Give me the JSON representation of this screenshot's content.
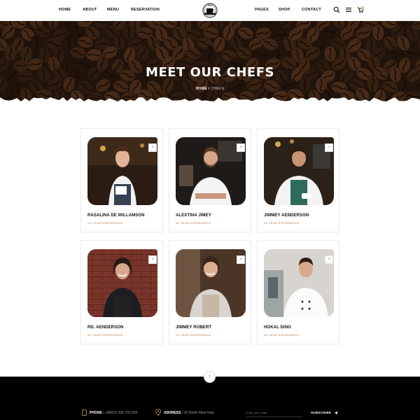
{
  "nav": {
    "left": [
      "HOME",
      "ABOUT",
      "MENU",
      "RESERVATION"
    ],
    "right": [
      "PAGES",
      "SHOP",
      "CONTACT"
    ],
    "cart_count": "0"
  },
  "hero": {
    "title": "MEET OUR CHEFS",
    "breadcrumb_home": "HOME",
    "breadcrumb_sep": " / ",
    "breadcrumb_current": "CHEFS"
  },
  "chefs": [
    {
      "name": "RASALINA DE WILLAMSON",
      "experience": "10 YEAR EXPERIENCE"
    },
    {
      "name": "ALEXTINA JIMEY",
      "experience": "06 YEAR EXPERIENCE"
    },
    {
      "name": "JIMMEY AENDERSON",
      "experience": "05 YEAR EXPERIENCE"
    },
    {
      "name": "RD. AENDERSON",
      "experience": "05 YEAR EXPERIENCE"
    },
    {
      "name": "JIMMEY ROBERT",
      "experience": "03 YEAR EXPERIENCE"
    },
    {
      "name": "HOKAL DINO",
      "experience": "05 YEAR EXPERIENCE"
    }
  ],
  "share_label": "+",
  "scroll_top_label": "↑",
  "footer": {
    "phone_label": "PHONE :",
    "phone_value": "+88019 339 702 520",
    "address_label": "ADDRESS :",
    "address_value": "30 North West New",
    "email_placeholder": "Enter your email",
    "subscribe_label": "SUBSCRIBE"
  },
  "colors": {
    "accent": "#c6a47b",
    "footer_bg": "#000000",
    "hero_bg": "#2a1a10"
  }
}
